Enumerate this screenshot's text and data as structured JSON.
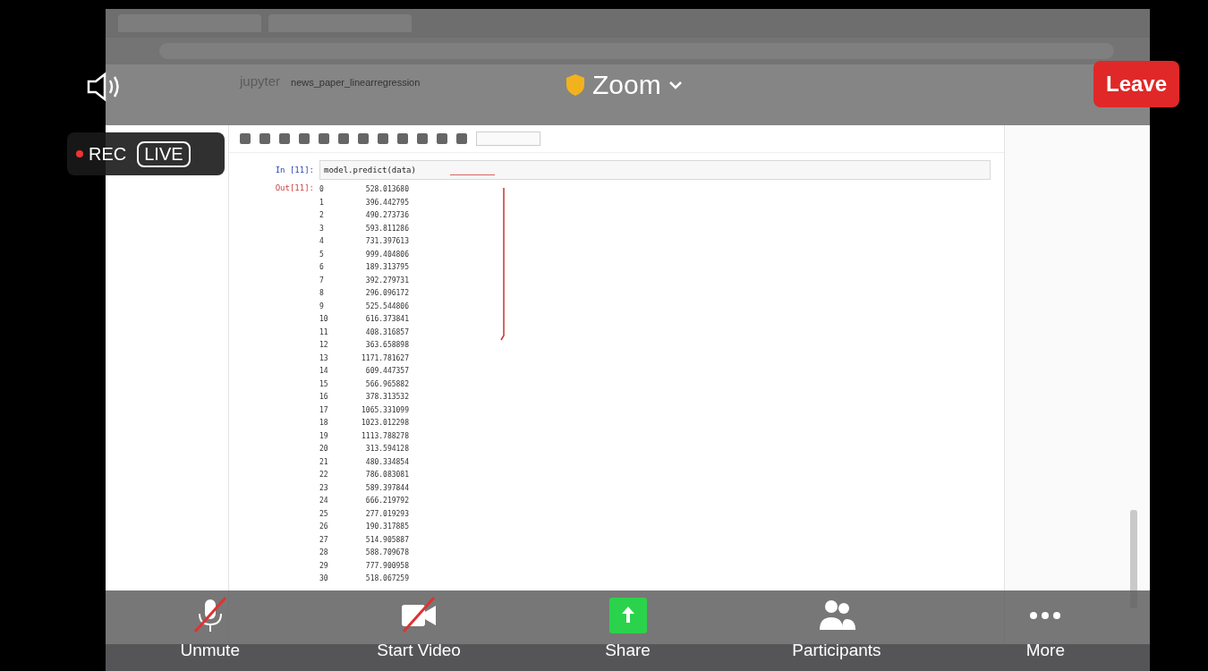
{
  "meeting": {
    "title": "Zoom",
    "leave_label": "Leave",
    "recording": {
      "rec_label": "REC",
      "live_label": "LIVE"
    }
  },
  "notebook": {
    "app_name": "jupyter",
    "name": "news_paper_linearregression",
    "cell": {
      "in_prompt": "In [11]:",
      "code": "model.predict(data)",
      "out_prompt": "Out[11]:",
      "rows": [
        {
          "index": "0",
          "value": "528.013680"
        },
        {
          "index": "1",
          "value": "396.442795"
        },
        {
          "index": "2",
          "value": "490.273736"
        },
        {
          "index": "3",
          "value": "593.811286"
        },
        {
          "index": "4",
          "value": "731.397613"
        },
        {
          "index": "5",
          "value": "999.404806"
        },
        {
          "index": "6",
          "value": "189.313795"
        },
        {
          "index": "7",
          "value": "392.279731"
        },
        {
          "index": "8",
          "value": "296.096172"
        },
        {
          "index": "9",
          "value": "525.544806"
        },
        {
          "index": "10",
          "value": "616.373841"
        },
        {
          "index": "11",
          "value": "408.316857"
        },
        {
          "index": "12",
          "value": "363.658898"
        },
        {
          "index": "13",
          "value": "1171.781627"
        },
        {
          "index": "14",
          "value": "609.447357"
        },
        {
          "index": "15",
          "value": "566.965882"
        },
        {
          "index": "16",
          "value": "378.313532"
        },
        {
          "index": "17",
          "value": "1065.331099"
        },
        {
          "index": "18",
          "value": "1023.012298"
        },
        {
          "index": "19",
          "value": "1113.788278"
        },
        {
          "index": "20",
          "value": "313.594128"
        },
        {
          "index": "21",
          "value": "480.334854"
        },
        {
          "index": "22",
          "value": "786.083081"
        },
        {
          "index": "23",
          "value": "589.397844"
        },
        {
          "index": "24",
          "value": "666.219792"
        },
        {
          "index": "25",
          "value": "277.019293"
        },
        {
          "index": "26",
          "value": "190.317885"
        },
        {
          "index": "27",
          "value": "514.905887"
        },
        {
          "index": "28",
          "value": "588.709678"
        },
        {
          "index": "29",
          "value": "777.900958"
        },
        {
          "index": "30",
          "value": "518.067259"
        }
      ]
    }
  },
  "controls": [
    {
      "kind": "audio",
      "label": "Unmute",
      "off": true
    },
    {
      "kind": "video",
      "label": "Start Video",
      "off": true
    },
    {
      "kind": "share",
      "label": "Share"
    },
    {
      "kind": "participants",
      "label": "Participants"
    },
    {
      "kind": "more",
      "label": "More"
    }
  ]
}
